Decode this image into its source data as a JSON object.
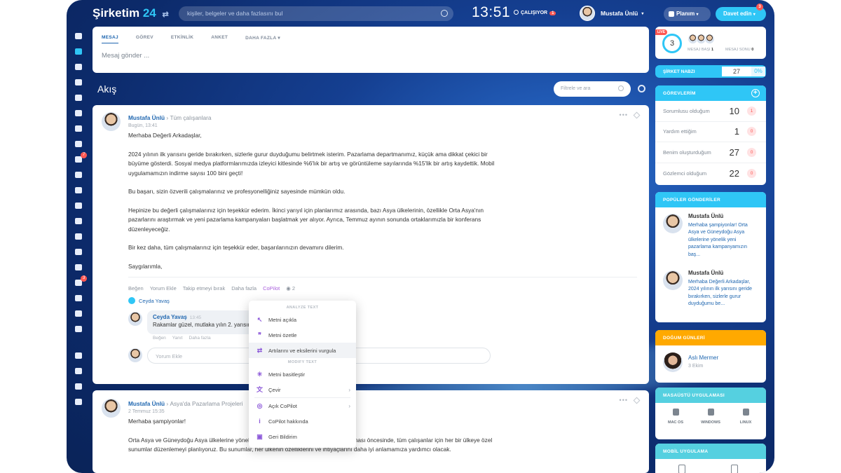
{
  "topbar": {
    "logo_main": "Şirketim",
    "logo_num": "24",
    "logo_mark": "⇄",
    "search_placeholder": "kişiler, belgeler ve daha fazlasını bul",
    "clock": "13:51",
    "status": "ÇALIŞIYOR",
    "status_badge": "1",
    "user_name": "Mustafa Ünlü",
    "plan_label": "Planım",
    "invite_label": "Davet edin",
    "invite_badge": "3"
  },
  "leftbar": {
    "badges": [
      "7",
      "3"
    ]
  },
  "composer": {
    "tabs": [
      "MESAJ",
      "GÖREV",
      "ETKİNLİK",
      "ANKET",
      "DAHA FAZLA"
    ],
    "placeholder": "Mesaj gönder ..."
  },
  "feed": {
    "title": "Akış",
    "filter_placeholder": "Filtrele ve ara"
  },
  "post1": {
    "author": "Mustafa Ünlü",
    "audience": "Tüm çalışanlara",
    "date": "Bugün, 13:41",
    "paragraphs": [
      "Merhaba Değerli Arkadaşlar,",
      "2024 yılının ilk yarısını geride bırakırken, sizlerle gurur duyduğumu belirtmek isterim. Pazarlama departmanımız, küçük ama dikkat çekici bir büyüme gösterdi. Sosyal medya platformlarımızda izleyici kitlesinde %6'lık bir artış ve görüntüleme sayılarında %15'lik bir artış kaydettik. Mobil uygulamamızın indirme sayısı 100 bini geçti!",
      "Bu başarı, sizin özverili çalışmalarınız ve profesyonelliğiniz sayesinde mümkün oldu.",
      "Hepinize bu değerli çalışmalarınız için teşekkür ederim. İkinci yarıyıl için planlarımız arasında, bazı Asya ülkelerinin, özellikle Orta Asya'nın pazarlarını araştırmak ve yeni pazarlama kampanyaları başlatmak yer alıyor. Ayrıca, Temmuz ayının sonunda ortaklarımızla bir konferans düzenleyeceğiz.",
      "Bir kez daha, tüm çalışmalarınız için teşekkür eder, başarılarınızın devamını dilerim.",
      "Saygılarımla,"
    ],
    "actions": [
      "Beğen",
      "Yorum Ekle",
      "Takip etmeyi bırak",
      "Daha fazla",
      "CoPilot"
    ],
    "views": "2",
    "liked_by": "Ceyda Yavaş",
    "comment": {
      "author": "Ceyda Yavaş",
      "time": "13:45",
      "text": "Rakamlar güzel, mutlaka yılın 2. yarısında da",
      "actions": [
        "Beğen",
        "Yanıt",
        "Daha fazla"
      ]
    },
    "reply_placeholder": "Yorum Ekle"
  },
  "post2": {
    "author": "Mustafa Ünlü",
    "audience": "Asya'da Pazarlama Projeleri",
    "date": "2 Temmuz 15:35",
    "paragraphs": [
      "Merhaba şampiyonlar!",
      "Orta Asya ve Güneydoğu Asya ülkelerine yönelik yeni pazarlama kampanyamızın başlaması öncesinde, tüm çalışanlar için her bir ülkeye özel sunumlar düzenlemeyi planlıyoruz. Bu sunumlar, her ülkenin özelliklerini ve ihtiyaçlarını daha iyi anlamamıza yardımcı olacak."
    ]
  },
  "copilot_menu": {
    "section_analyze": "ANALYZE TEXT",
    "section_modify": "MODIFY TEXT",
    "items_analyze": [
      "Metni açıkla",
      "Metni özetle",
      "Artılarını ve eksilerini vurgula"
    ],
    "items_modify": [
      "Metni basitleştir",
      "Çevir"
    ],
    "items_other": [
      "Açık CoPilot",
      "CoPilot hakkında",
      "Geri Bildirim"
    ]
  },
  "sidebar": {
    "live": {
      "badge": "LIVE",
      "count": "3",
      "label_start": "MESAJ BAŞI",
      "label_start_n": "1",
      "label_end": "MESAJ SONU",
      "label_end_n": "0"
    },
    "pulse": {
      "label": "ŞİRKET NABZI",
      "value": "27",
      "percent": "0%"
    },
    "tasks": {
      "title": "GÖREVLERİM",
      "rows": [
        {
          "label": "Sorumlusu olduğum",
          "count": "10",
          "badge": "1"
        },
        {
          "label": "Yardım ettiğim",
          "count": "1",
          "badge": "0"
        },
        {
          "label": "Benim oluşturduğum",
          "count": "27",
          "badge": "0"
        },
        {
          "label": "Gözlemci olduğum",
          "count": "22",
          "badge": "0"
        }
      ]
    },
    "popular": {
      "title": "POPÜLER GÖNDERİLER",
      "items": [
        {
          "author": "Mustafa Ünlü",
          "text": "Merhaba şampiyonlar! Orta Asya ve Güneydoğu Asya ülkelerine yönelik yeni pazarlama kampanyamızın baş..."
        },
        {
          "author": "Mustafa Ünlü",
          "text": "Merhaba Değerli Arkadaşlar, 2024 yılının ilk yarısını geride bırakırken, sizlerle gurur duyduğumu be..."
        }
      ]
    },
    "birthdays": {
      "title": "DOĞUM GÜNLERİ",
      "name": "Aslı Mermer",
      "date": "3 Ekim"
    },
    "desktop": {
      "title": "MASAÜSTÜ UYGULAMASI",
      "os": [
        "MAC OS",
        "WINDOWS",
        "LINUX"
      ]
    },
    "mobile": {
      "title": "MOBİL UYGULAMA"
    }
  }
}
